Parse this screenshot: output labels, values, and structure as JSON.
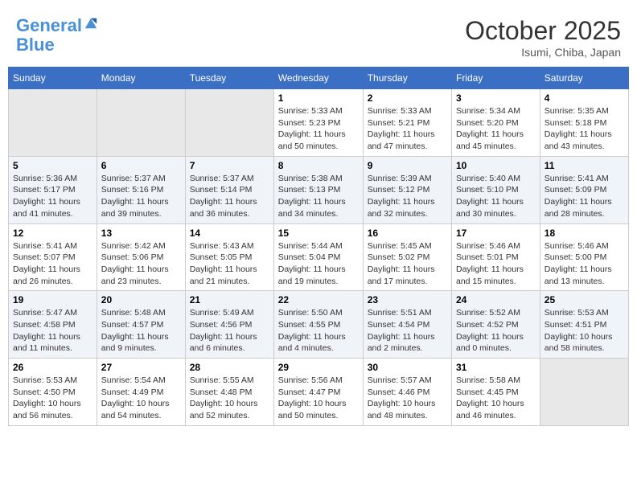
{
  "header": {
    "logo_line1": "General",
    "logo_line2": "Blue",
    "month": "October 2025",
    "location": "Isumi, Chiba, Japan"
  },
  "weekdays": [
    "Sunday",
    "Monday",
    "Tuesday",
    "Wednesday",
    "Thursday",
    "Friday",
    "Saturday"
  ],
  "weeks": [
    [
      {
        "day": "",
        "info": ""
      },
      {
        "day": "",
        "info": ""
      },
      {
        "day": "",
        "info": ""
      },
      {
        "day": "1",
        "info": "Sunrise: 5:33 AM\nSunset: 5:23 PM\nDaylight: 11 hours\nand 50 minutes."
      },
      {
        "day": "2",
        "info": "Sunrise: 5:33 AM\nSunset: 5:21 PM\nDaylight: 11 hours\nand 47 minutes."
      },
      {
        "day": "3",
        "info": "Sunrise: 5:34 AM\nSunset: 5:20 PM\nDaylight: 11 hours\nand 45 minutes."
      },
      {
        "day": "4",
        "info": "Sunrise: 5:35 AM\nSunset: 5:18 PM\nDaylight: 11 hours\nand 43 minutes."
      }
    ],
    [
      {
        "day": "5",
        "info": "Sunrise: 5:36 AM\nSunset: 5:17 PM\nDaylight: 11 hours\nand 41 minutes."
      },
      {
        "day": "6",
        "info": "Sunrise: 5:37 AM\nSunset: 5:16 PM\nDaylight: 11 hours\nand 39 minutes."
      },
      {
        "day": "7",
        "info": "Sunrise: 5:37 AM\nSunset: 5:14 PM\nDaylight: 11 hours\nand 36 minutes."
      },
      {
        "day": "8",
        "info": "Sunrise: 5:38 AM\nSunset: 5:13 PM\nDaylight: 11 hours\nand 34 minutes."
      },
      {
        "day": "9",
        "info": "Sunrise: 5:39 AM\nSunset: 5:12 PM\nDaylight: 11 hours\nand 32 minutes."
      },
      {
        "day": "10",
        "info": "Sunrise: 5:40 AM\nSunset: 5:10 PM\nDaylight: 11 hours\nand 30 minutes."
      },
      {
        "day": "11",
        "info": "Sunrise: 5:41 AM\nSunset: 5:09 PM\nDaylight: 11 hours\nand 28 minutes."
      }
    ],
    [
      {
        "day": "12",
        "info": "Sunrise: 5:41 AM\nSunset: 5:07 PM\nDaylight: 11 hours\nand 26 minutes."
      },
      {
        "day": "13",
        "info": "Sunrise: 5:42 AM\nSunset: 5:06 PM\nDaylight: 11 hours\nand 23 minutes."
      },
      {
        "day": "14",
        "info": "Sunrise: 5:43 AM\nSunset: 5:05 PM\nDaylight: 11 hours\nand 21 minutes."
      },
      {
        "day": "15",
        "info": "Sunrise: 5:44 AM\nSunset: 5:04 PM\nDaylight: 11 hours\nand 19 minutes."
      },
      {
        "day": "16",
        "info": "Sunrise: 5:45 AM\nSunset: 5:02 PM\nDaylight: 11 hours\nand 17 minutes."
      },
      {
        "day": "17",
        "info": "Sunrise: 5:46 AM\nSunset: 5:01 PM\nDaylight: 11 hours\nand 15 minutes."
      },
      {
        "day": "18",
        "info": "Sunrise: 5:46 AM\nSunset: 5:00 PM\nDaylight: 11 hours\nand 13 minutes."
      }
    ],
    [
      {
        "day": "19",
        "info": "Sunrise: 5:47 AM\nSunset: 4:58 PM\nDaylight: 11 hours\nand 11 minutes."
      },
      {
        "day": "20",
        "info": "Sunrise: 5:48 AM\nSunset: 4:57 PM\nDaylight: 11 hours\nand 9 minutes."
      },
      {
        "day": "21",
        "info": "Sunrise: 5:49 AM\nSunset: 4:56 PM\nDaylight: 11 hours\nand 6 minutes."
      },
      {
        "day": "22",
        "info": "Sunrise: 5:50 AM\nSunset: 4:55 PM\nDaylight: 11 hours\nand 4 minutes."
      },
      {
        "day": "23",
        "info": "Sunrise: 5:51 AM\nSunset: 4:54 PM\nDaylight: 11 hours\nand 2 minutes."
      },
      {
        "day": "24",
        "info": "Sunrise: 5:52 AM\nSunset: 4:52 PM\nDaylight: 11 hours\nand 0 minutes."
      },
      {
        "day": "25",
        "info": "Sunrise: 5:53 AM\nSunset: 4:51 PM\nDaylight: 10 hours\nand 58 minutes."
      }
    ],
    [
      {
        "day": "26",
        "info": "Sunrise: 5:53 AM\nSunset: 4:50 PM\nDaylight: 10 hours\nand 56 minutes."
      },
      {
        "day": "27",
        "info": "Sunrise: 5:54 AM\nSunset: 4:49 PM\nDaylight: 10 hours\nand 54 minutes."
      },
      {
        "day": "28",
        "info": "Sunrise: 5:55 AM\nSunset: 4:48 PM\nDaylight: 10 hours\nand 52 minutes."
      },
      {
        "day": "29",
        "info": "Sunrise: 5:56 AM\nSunset: 4:47 PM\nDaylight: 10 hours\nand 50 minutes."
      },
      {
        "day": "30",
        "info": "Sunrise: 5:57 AM\nSunset: 4:46 PM\nDaylight: 10 hours\nand 48 minutes."
      },
      {
        "day": "31",
        "info": "Sunrise: 5:58 AM\nSunset: 4:45 PM\nDaylight: 10 hours\nand 46 minutes."
      },
      {
        "day": "",
        "info": ""
      }
    ]
  ]
}
